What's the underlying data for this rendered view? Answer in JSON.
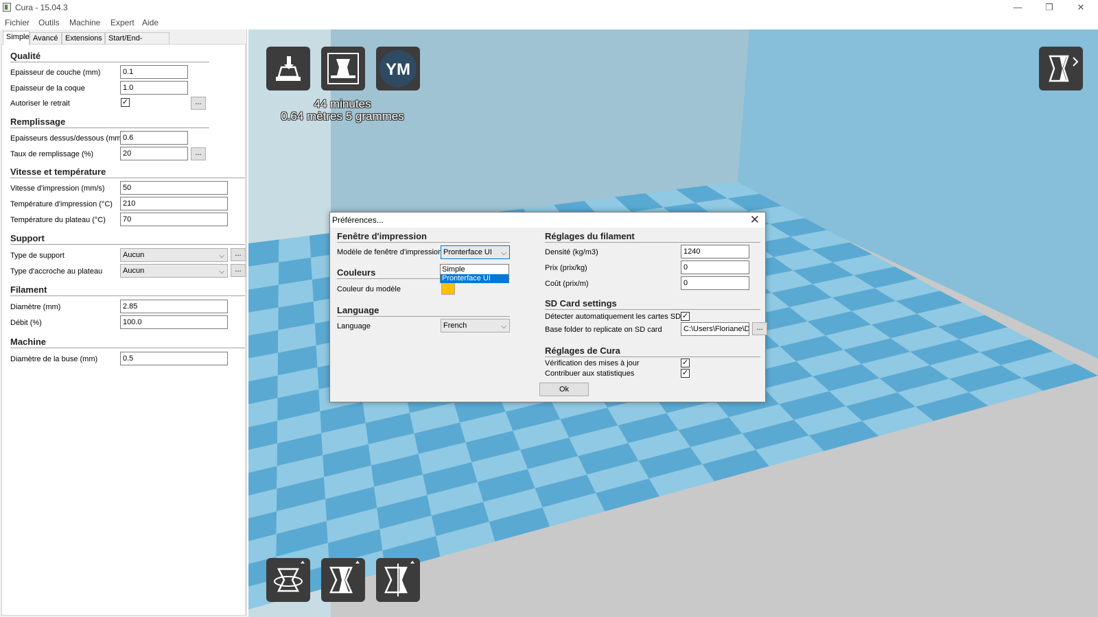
{
  "window": {
    "title": "Cura - 15.04.3",
    "minimize_glyph": "—",
    "maximize_glyph": "❐",
    "close_glyph": "✕"
  },
  "menu": [
    "Fichier",
    "Outils",
    "Machine",
    "Expert",
    "Aide"
  ],
  "tabs": [
    "Simple",
    "Avancé",
    "Extensions",
    "Start/End-GCode"
  ],
  "active_tab": "Simple",
  "panel": {
    "quality": {
      "title": "Qualité",
      "layer_height_label": "Epaisseur de couche (mm)",
      "layer_height_value": "0.1",
      "shell_label": "Epaisseur de la coque",
      "shell_value": "1.0",
      "retraction_label": "Autoriser le retrait",
      "retraction_checked": "✓"
    },
    "fill": {
      "title": "Remplissage",
      "top_bottom_label": "Epaisseurs dessus/dessous (mm)",
      "top_bottom_value": "0.6",
      "density_label": "Taux de remplissage (%)",
      "density_value": "20"
    },
    "speed": {
      "title": "Vitesse et température",
      "print_speed_label": "Vitesse d'impression (mm/s)",
      "print_speed_value": "50",
      "print_temp_label": "Température d'impression (°C)",
      "print_temp_value": "210",
      "bed_temp_label": "Température du plateau (°C)",
      "bed_temp_value": "70"
    },
    "support": {
      "title": "Support",
      "type_label": "Type de support",
      "type_value": "Aucun",
      "adhesion_label": "Type d'accroche au plateau",
      "adhesion_value": "Aucun"
    },
    "filament": {
      "title": "Filament",
      "diameter_label": "Diamètre (mm)",
      "diameter_value": "2.85",
      "flow_label": "Débit (%)",
      "flow_value": "100.0"
    },
    "machine": {
      "title": "Machine",
      "nozzle_label": "Diamètre de la buse (mm)",
      "nozzle_value": "0.5"
    },
    "more_button": "...",
    "combo_chevron": "⌵"
  },
  "viewport": {
    "load_icon": "load-model-icon",
    "save_icon": "save-gcode-icon",
    "ym_label": "YM",
    "print_time": "44 minutes",
    "print_material": "0.64 mètres 5 grammes",
    "colors": {
      "back_wall": "#9fc3d2",
      "side_wall": "#87bed9",
      "floor_light": "#5aa9d3",
      "floor_dark": "#8fc9e3",
      "outer_floor": "#c9c9c9",
      "button": "#3c3c3c"
    }
  },
  "dialog": {
    "title": "Préférences...",
    "close": "✕",
    "print_window": {
      "title": "Fenêtre d'impression",
      "model_label": "Modèle de fenêtre d'impression",
      "model_value": "Pronterface UI",
      "options": [
        "Simple",
        "Pronterface UI"
      ],
      "selected_option": "Pronterface UI"
    },
    "colors": {
      "title": "Couleurs",
      "model_color_label": "Couleur du modèle",
      "model_color": "#ffc000"
    },
    "language": {
      "title": "Language",
      "label": "Language",
      "value": "French"
    },
    "filament": {
      "title": "Réglages du filament",
      "density_label": "Densité (kg/m3)",
      "density_value": "1240",
      "price_label": "Prix (prix/kg)",
      "price_value": "0",
      "cost_label": "Coût (prix/m)",
      "cost_value": "0"
    },
    "sd_card": {
      "title": "SD Card settings",
      "autodetect_label": "Détecter automatiquement les cartes SD",
      "autodetect_checked": "✓",
      "base_folder_label": "Base folder to replicate on SD card",
      "base_folder_value": "C:\\Users\\Floriane\\D"
    },
    "cura": {
      "title": "Réglages de Cura",
      "updates_label": "Vérification des mises à jour",
      "updates_checked": "✓",
      "stats_label": "Contribuer aux statistiques",
      "stats_checked": "✓"
    },
    "ok": "Ok",
    "browse": "..."
  }
}
